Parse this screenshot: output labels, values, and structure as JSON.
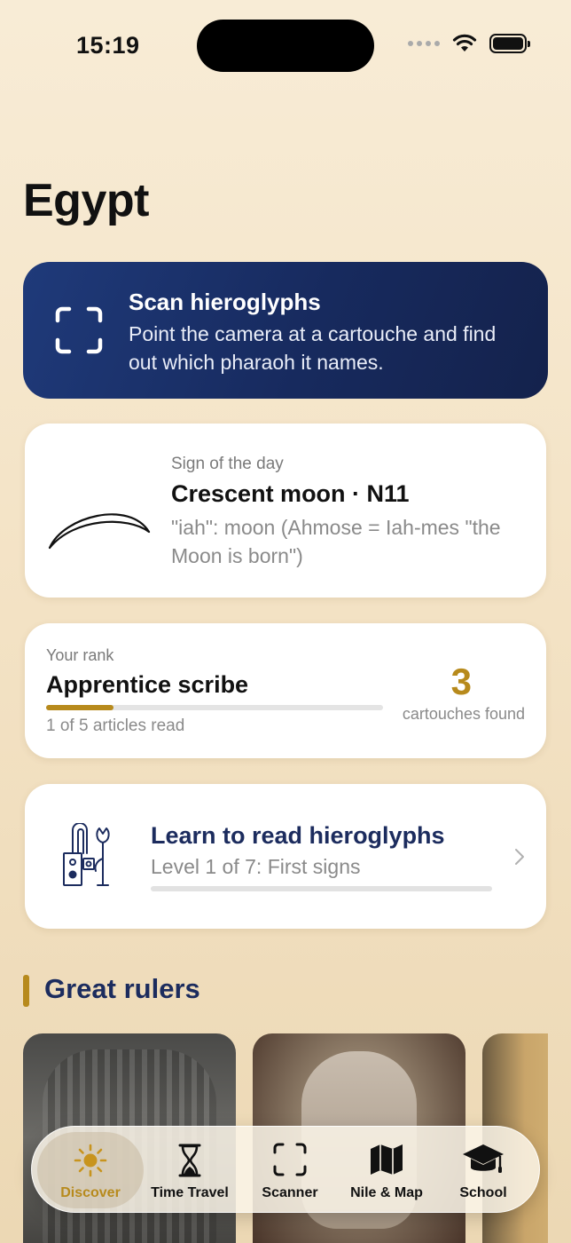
{
  "status_bar": {
    "time": "15:19"
  },
  "page_title": "Egypt",
  "scan_card": {
    "title": "Scan hieroglyphs",
    "subtitle": "Point the camera at a cartouche and find out which pharaoh it names."
  },
  "sign_of_day": {
    "overline": "Sign of the day",
    "title": "Crescent moon · N11",
    "description": "\"iah\": moon (Ahmose = Iah-mes \"the Moon is born\")"
  },
  "rank": {
    "overline": "Your rank",
    "title": "Apprentice scribe",
    "progress_fraction": 0.2,
    "progress_text": "1 of 5 articles read",
    "count": "3",
    "count_label": "cartouches found"
  },
  "learn": {
    "title": "Learn to read hieroglyphs",
    "subtitle": "Level 1 of 7: First signs",
    "progress_fraction": 0.0
  },
  "section": {
    "title": "Great rulers"
  },
  "rulers": [
    {
      "icon": "narmer-palette-image"
    },
    {
      "icon": "sphinx-head-image"
    },
    {
      "icon": "ruler-image-partial"
    }
  ],
  "tab_bar": {
    "active": "discover",
    "tabs": [
      {
        "id": "discover",
        "label": "Discover",
        "icon": "sun-icon"
      },
      {
        "id": "time-travel",
        "label": "Time Travel",
        "icon": "hourglass-icon"
      },
      {
        "id": "scanner",
        "label": "Scanner",
        "icon": "scan-frame-icon"
      },
      {
        "id": "nile-map",
        "label": "Nile & Map",
        "icon": "map-icon"
      },
      {
        "id": "school",
        "label": "School",
        "icon": "graduation-cap-icon"
      }
    ]
  },
  "colors": {
    "accent_gold": "#b78a1c",
    "navy": "#1c2c5e",
    "scan_card_bg": "#1f3a7a"
  }
}
